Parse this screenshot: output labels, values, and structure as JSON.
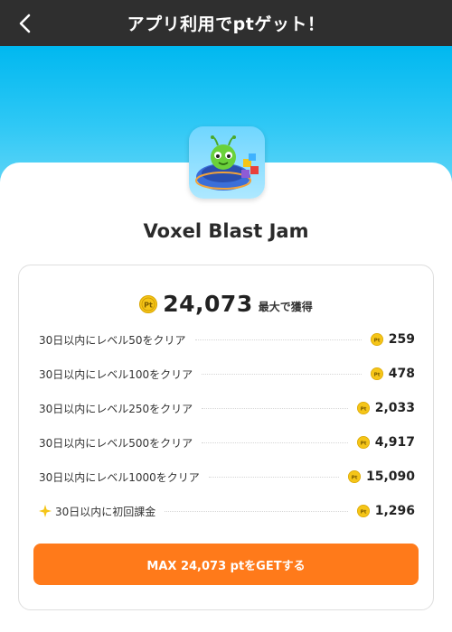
{
  "header": {
    "title": "アプリ利用でptゲット！",
    "back_icon": "chevron-left-icon"
  },
  "colors": {
    "header_bg": "#2f2f2f",
    "banner": "#00b8f0",
    "cta": "#ff7a1a",
    "coin": "#f5c518"
  },
  "app": {
    "name": "Voxel Blast Jam",
    "icon": "app-icon-caterpillar-blocks"
  },
  "rewards": {
    "total_value": "24,073",
    "total_suffix": "最大で獲得",
    "coin_icon": "pt-coin-icon",
    "items": [
      {
        "label": "30日以内にレベル50をクリア",
        "value": "259"
      },
      {
        "label": "30日以内にレベル100をクリア",
        "value": "478"
      },
      {
        "label": "30日以内にレベル250をクリア",
        "value": "2,033"
      },
      {
        "label": "30日以内にレベル500をクリア",
        "value": "4,917"
      },
      {
        "label": "30日以内にレベル1000をクリア",
        "value": "15,090"
      },
      {
        "label": "30日以内に初回課金",
        "value": "1,296",
        "icon": "sparkle-icon"
      }
    ]
  },
  "cta": {
    "label": "MAX 24,073 ptをGETする"
  }
}
